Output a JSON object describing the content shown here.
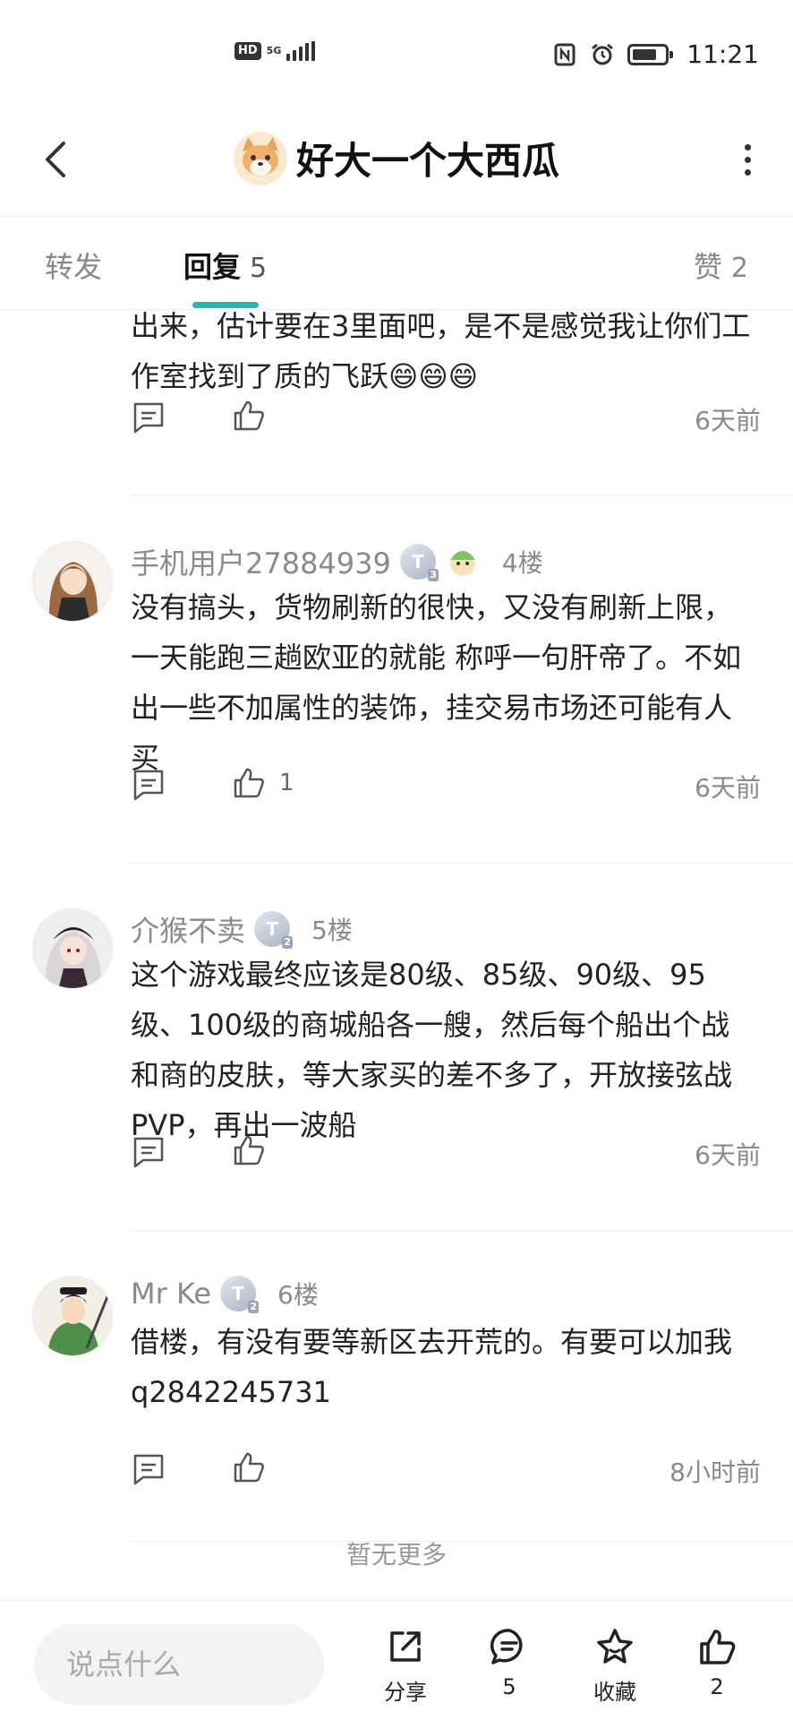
{
  "status_bar": {
    "hd": "HD",
    "net": "5G",
    "time": "11:21"
  },
  "header": {
    "title": "好大一个大西瓜"
  },
  "tabs": {
    "repost": {
      "label": "转发"
    },
    "reply": {
      "label": "回复",
      "count": "5"
    },
    "like": {
      "label": "赞",
      "count": "2"
    }
  },
  "comments": [
    {
      "text": "出来，估计要在3里面吧，是不是感觉我让你们工作室找到了质的飞跃😄😄😄",
      "likes": "",
      "time": "6天前"
    },
    {
      "user": "手机用户27884939",
      "badge": "T",
      "badge_level": "3",
      "floor": "4楼",
      "text": "没有搞头，货物刷新的很快，又没有刷新上限，一天能跑三趟欧亚的就能 称呼一句肝帝了。不如出一些不加属性的装饰，挂交易市场还可能有人买",
      "likes": "1",
      "time": "6天前"
    },
    {
      "user": "介猴不卖",
      "badge": "T",
      "badge_level": "2",
      "floor": "5楼",
      "text": "这个游戏最终应该是80级、85级、90级、95级、100级的商城船各一艘，然后每个船出个战和商的皮肤，等大家买的差不多了，开放接弦战PVP，再出一波船",
      "likes": "",
      "time": "6天前"
    },
    {
      "user": "Mr Ke",
      "badge": "T",
      "badge_level": "2",
      "floor": "6楼",
      "text": "借楼，有没有要等新区去开荒的。有要可以加我q2842245731",
      "likes": "",
      "time": "8小时前"
    }
  ],
  "no_more": "暂无更多",
  "bottom_bar": {
    "input_placeholder": "说点什么",
    "share_label": "分享",
    "comment_count": "5",
    "favorite_label": "收藏",
    "like_count": "2"
  },
  "colors": {
    "accent": "#2ab6b0",
    "muted_text": "#8a8a8a"
  }
}
